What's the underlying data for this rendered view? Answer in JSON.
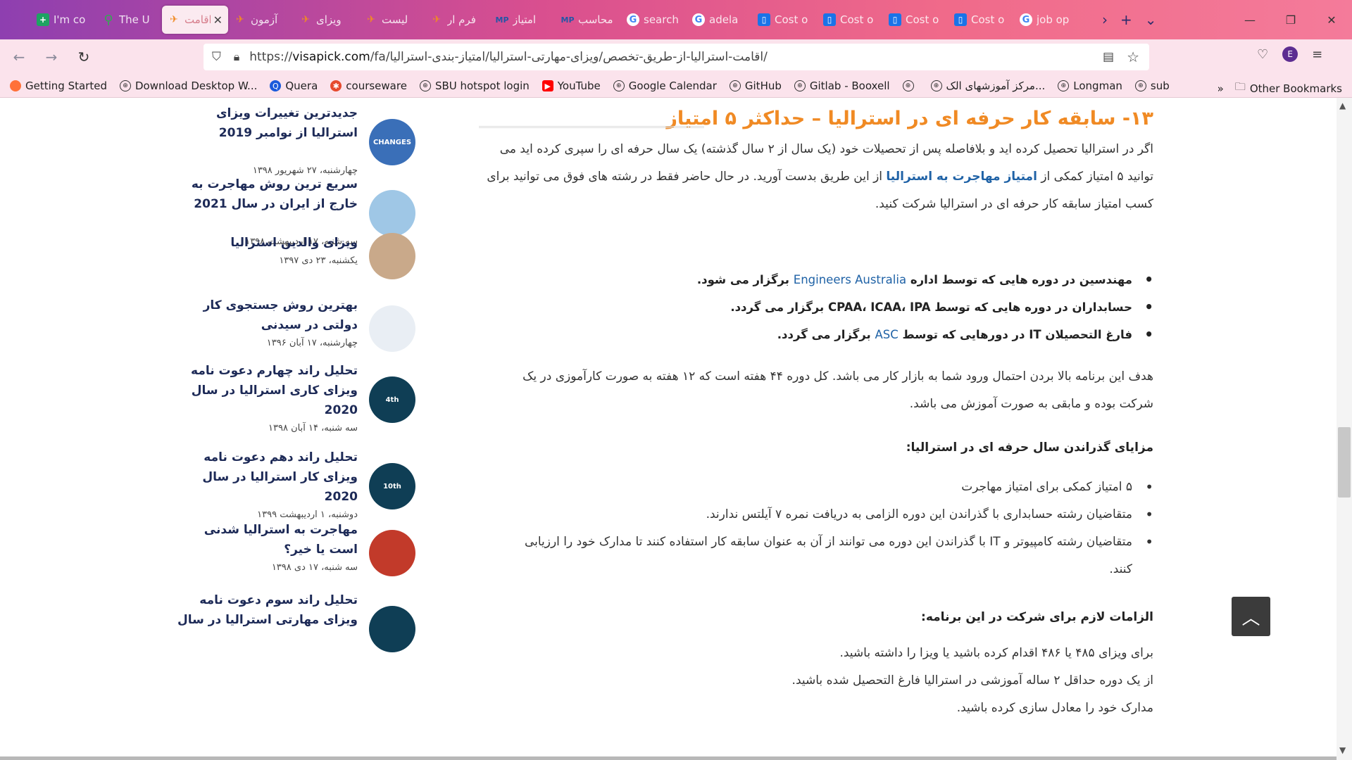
{
  "tabs": [
    {
      "label": "I'm co",
      "icon": "plus-icon"
    },
    {
      "label": "The U",
      "icon": "maps-pin-icon"
    },
    {
      "label": "اقامت",
      "icon": "visapick-icon",
      "active": true
    },
    {
      "label": "آزمون",
      "icon": "visapick-icon"
    },
    {
      "label": "ویزای",
      "icon": "visapick-icon"
    },
    {
      "label": "لیست",
      "icon": "visapick-icon"
    },
    {
      "label": "فرم ار",
      "icon": "visapick-icon"
    },
    {
      "label": "امتیاز",
      "icon": "mp-icon"
    },
    {
      "label": "محاسب",
      "icon": "mp-icon"
    },
    {
      "label": "search",
      "icon": "google-icon"
    },
    {
      "label": "adela",
      "icon": "google-icon"
    },
    {
      "label": "Cost o",
      "icon": "cost-icon"
    },
    {
      "label": "Cost o",
      "icon": "cost-icon"
    },
    {
      "label": "Cost o",
      "icon": "cost-icon"
    },
    {
      "label": "Cost o",
      "icon": "cost-icon"
    },
    {
      "label": "job op",
      "icon": "google-icon"
    }
  ],
  "url": {
    "prefix": "https://",
    "host": "visapick.com",
    "path": "/fa/اقامت-استرالیا-از-طریق-تخصص/ویزای-مهارتی-استرالیا/امتیاز-بندی-استرالیا/"
  },
  "bookmarks": [
    {
      "label": "Getting Started",
      "icon": "firefox-icon"
    },
    {
      "label": "Download Desktop W...",
      "icon": "globe-icon"
    },
    {
      "label": "Quera",
      "icon": "quera-icon"
    },
    {
      "label": "courseware",
      "icon": "courseware-icon"
    },
    {
      "label": "SBU hotspot login",
      "icon": "globe-icon"
    },
    {
      "label": "YouTube",
      "icon": "youtube-icon"
    },
    {
      "label": "Google Calendar",
      "icon": "globe-icon"
    },
    {
      "label": "GitHub",
      "icon": "globe-icon"
    },
    {
      "label": "Gitlab - Booxell",
      "icon": "globe-icon"
    },
    {
      "label": "",
      "icon": "globe-icon"
    },
    {
      "label": "مرکز آموزشهای الک...",
      "icon": "globe-icon"
    },
    {
      "label": "Longman",
      "icon": "globe-icon"
    },
    {
      "label": "sub",
      "icon": "globe-icon"
    }
  ],
  "other_bookmarks": "Other Bookmarks",
  "avatar_letter": "E",
  "sidebar_posts": [
    {
      "title": "جدیدترین تغییرات ویزای استرالیا از نوامبر 2019",
      "date": "چهارشنبه، ۲۷ شهریور ۱۳۹۸",
      "thumb_text": "CHANGES"
    },
    {
      "title": "سریع ترین روش مهاجرت به خارج از ایران در سال 2021",
      "date": "سه شنبه، ۱۷ اردیبهشت ۱۳۹۸",
      "thumb_text": ""
    },
    {
      "title": "ویزای والدین استرالیا",
      "date": "یکشنبه، ۲۳ دی ۱۳۹۷",
      "thumb_text": ""
    },
    {
      "title": "بهترین روش جستجوی کار دولتی در سیدنی",
      "date": "چهارشنبه، ۱۷ آبان ۱۳۹۶",
      "thumb_text": ""
    },
    {
      "title": "تحلیل راند چهارم دعوت نامه ویزای کاری استرالیا در سال 2020",
      "date": "سه شنبه، ۱۴ آبان ۱۳۹۸",
      "thumb_text": "4th"
    },
    {
      "title": "تحلیل راند دهم دعوت نامه ویزای کار استرالیا در سال 2020",
      "date": "دوشنبه، ۱ اردیبهشت ۱۳۹۹",
      "thumb_text": "10th"
    },
    {
      "title": "مهاجرت به استرالیا شدنی است یا خیر؟",
      "date": "سه شنبه، ۱۷ دی ۱۳۹۸",
      "thumb_text": ""
    },
    {
      "title": "تحلیل راند سوم دعوت نامه ویزای مهارتی استرالیا در سال",
      "date": "",
      "thumb_text": ""
    }
  ],
  "article": {
    "heading": "۱۳- سابقه کار حرفه ای در استرالیا – حداکثر ۵ امتیاز",
    "p1_line1": "اگر در استرالیا تحصیل کرده اید و بلافاصله پس از تحصیلات خود (یک سال از ۲ سال گذشته) یک سال حرفه ای را سپری کرده اید می",
    "p1_line2_a": "توانید ۵ امتیاز کمکی از",
    "p1_link": "امتیاز مهاجرت به استرالیا",
    "p1_line2_b": "از این طریق بدست آورید. در حال حاضر فقط در رشته های فوق می توانید برای",
    "p1_line3": "کسب امتیاز سابقه کار حرفه ای در استرالیا شرکت کنید.",
    "bullets": [
      {
        "a": "مهندسین در دوره هایی که توسط اداره",
        "link": "Engineers Australia",
        "b": "برگزار می شود."
      },
      {
        "a": "حسابداران در دوره هایی که توسط CPAA، ICAA، IPA برگزار می گردد.",
        "link": "",
        "b": ""
      },
      {
        "a": "فارغ التحصیلان IT در دورهایی که توسط",
        "link": "ASC",
        "b": "برگزار می گردد."
      }
    ],
    "p2_line1": "هدف این برنامه بالا بردن احتمال ورود شما به بازار کار می باشد. کل دوره ۴۴ هفته است که ۱۲ هفته به صورت کارآموزی در یک",
    "p2_line2": "شرکت بوده و مابقی به صورت آموزش می باشد.",
    "benefits_heading": "مزایای گذراندن سال حرفه ای در استرالیا:",
    "benefits": [
      "۵ امتیاز کمکی برای امتیاز مهاجرت",
      "متقاضیان رشته حسابداری با گذراندن این دوره الزامی به دریافت نمره ۷ آیلتس ندارند.",
      "متقاضیان رشته کامپیوتر و IT با گذراندن این دوره می توانند از آن به عنوان سابقه کار استفاده کنند تا مدارک خود را ارزیابی",
      "کنند."
    ],
    "req_heading": "الزامات لازم برای شرکت در این برنامه:",
    "requirements": [
      "برای ویزای ۴۸۵ یا ۴۸۶ اقدام کرده باشید یا ویزا را داشته باشید.",
      "از یک دوره حداقل ۲ ساله آموزشی در استرالیا فارغ التحصیل شده باشید.",
      "مدارک خود را معادل سازی کرده باشید."
    ]
  },
  "colors": {
    "heading_orange": "#f08a24",
    "link_blue": "#1f62a6",
    "sidebar_title": "#1d2a57"
  }
}
